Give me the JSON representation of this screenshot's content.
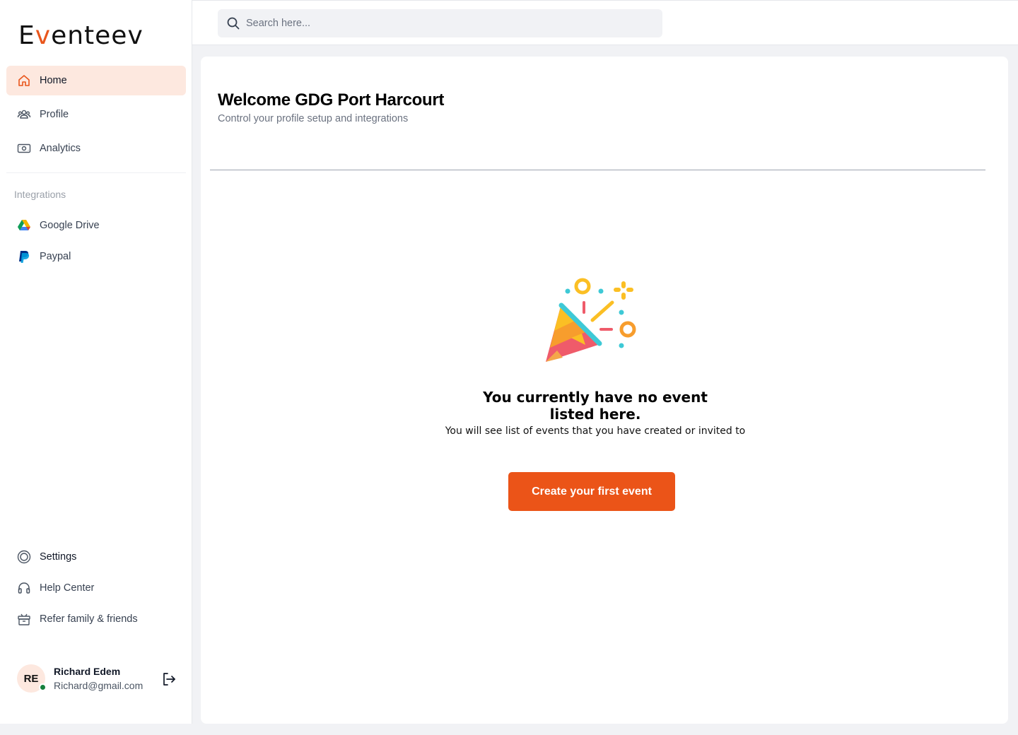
{
  "brand": {
    "logo_text_prefix": "E",
    "logo_text_accent": "v",
    "logo_text_suffix": "enteev",
    "accent_color": "#eb5418"
  },
  "sidebar": {
    "nav": [
      {
        "label": "Home",
        "icon": "home-icon",
        "active": true
      },
      {
        "label": "Profile",
        "icon": "users-icon",
        "active": false
      },
      {
        "label": "Analytics",
        "icon": "money-icon",
        "active": false
      }
    ],
    "integrations_label": "Integrations",
    "integrations": [
      {
        "label": "Google Drive",
        "icon": "google-drive-icon"
      },
      {
        "label": "Paypal",
        "icon": "paypal-icon"
      }
    ],
    "bottom": [
      {
        "label": "Settings",
        "icon": "settings-icon"
      },
      {
        "label": "Help Center",
        "icon": "headset-icon"
      },
      {
        "label": "Refer family & friends",
        "icon": "gift-box-icon"
      }
    ],
    "user": {
      "initials": "RE",
      "name": "Richard Edem",
      "email": "Richard@gmail.com",
      "status": "online"
    }
  },
  "search": {
    "placeholder": "Search here..."
  },
  "main": {
    "title": "Welcome GDG Port Harcourt",
    "subtitle": "Control your profile setup and integrations",
    "empty_state": {
      "illustration": "party-popper-icon",
      "title": "You currently have no event listed here.",
      "description": "You will see list of events that you have created or invited to",
      "cta_label": "Create your first event"
    }
  }
}
